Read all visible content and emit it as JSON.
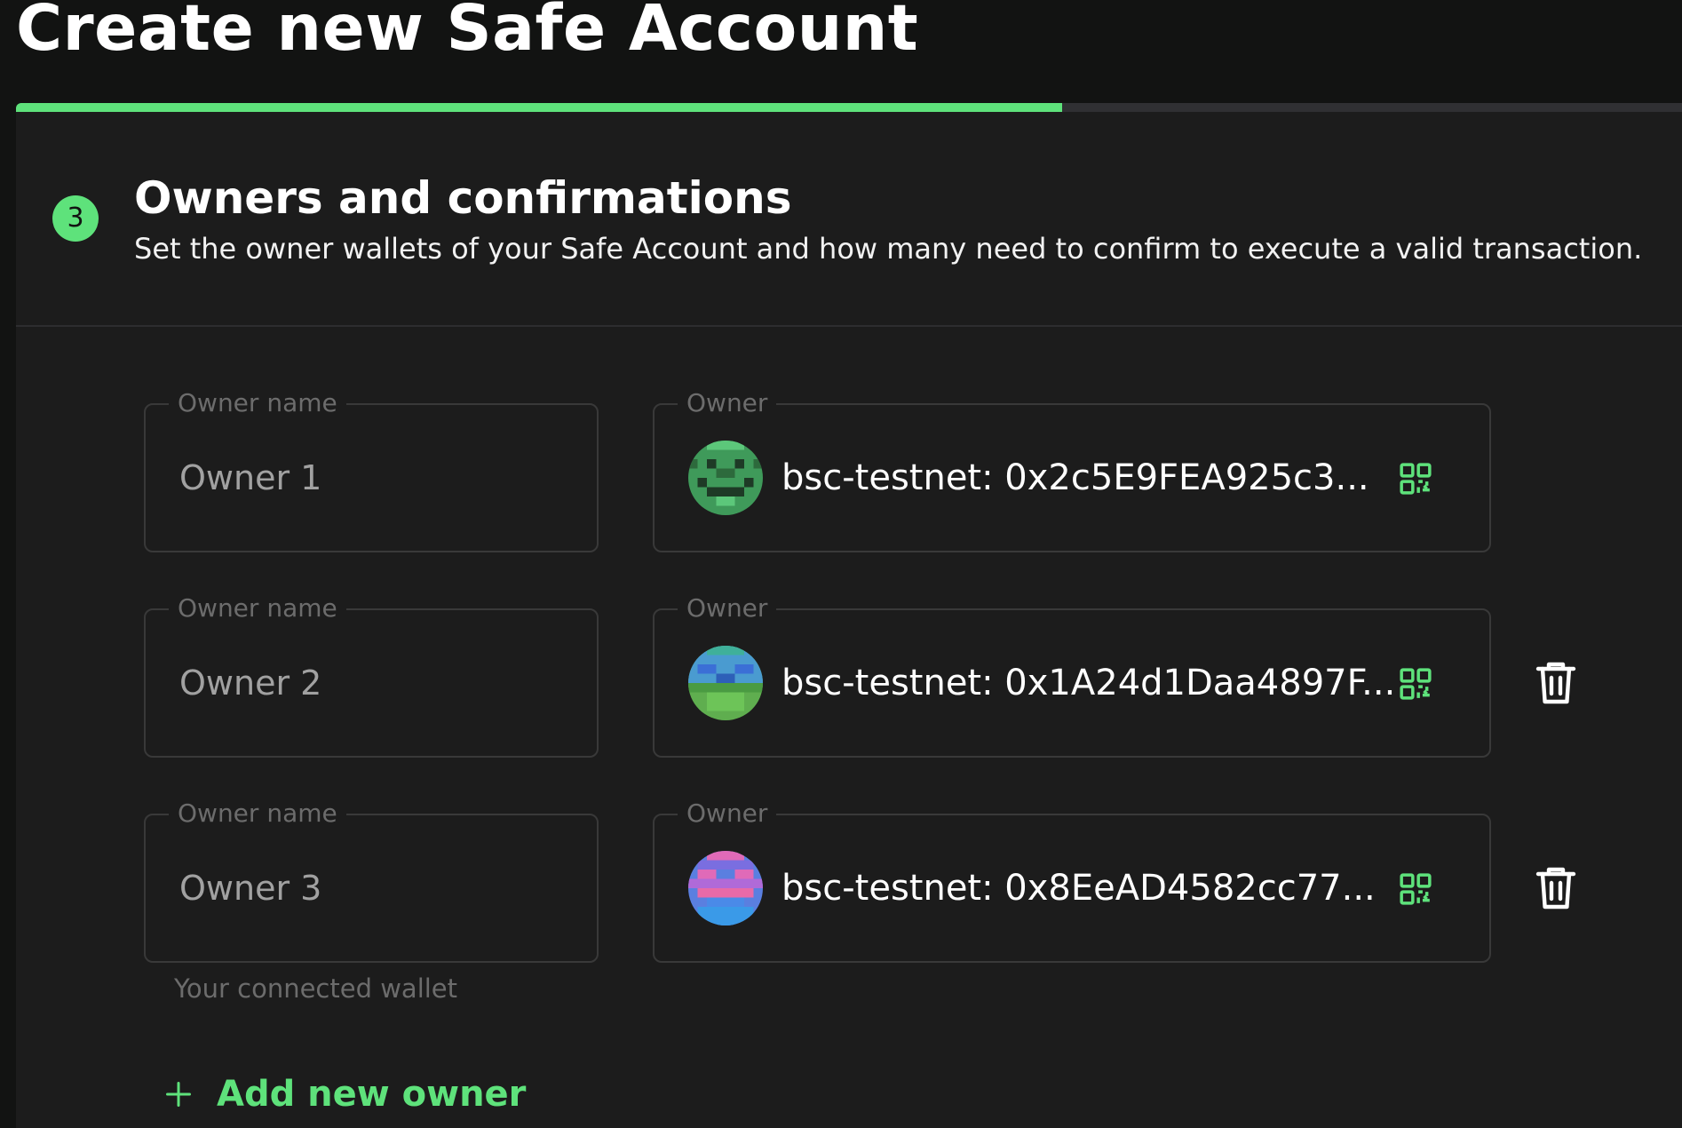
{
  "page": {
    "title": "Create new Safe Account"
  },
  "progress": {
    "percent": 62.8,
    "color": "#5ee27b"
  },
  "step": {
    "number": "3",
    "title": "Owners and confirmations",
    "subtitle": "Set the owner wallets of your Safe Account and how many need to confirm to execute a valid transaction."
  },
  "owners": [
    {
      "name_label": "Owner name",
      "name": "Owner 1",
      "address_label": "Owner",
      "address": "bsc-testnet: 0x2c5E9FEA925c3...",
      "deletable": false
    },
    {
      "name_label": "Owner name",
      "name": "Owner 2",
      "address_label": "Owner",
      "address": "bsc-testnet: 0x1A24d1Daa4897F...",
      "deletable": true
    },
    {
      "name_label": "Owner name",
      "name": "Owner 3",
      "address_label": "Owner",
      "address": "bsc-testnet: 0x8EeAD4582cc77...",
      "deletable": true
    }
  ],
  "helper_text": "Your connected wallet",
  "add_owner_label": "Add new owner",
  "icons": {
    "qr": "qr-code-icon",
    "delete": "trash-icon",
    "add": "plus-icon"
  },
  "colors": {
    "accent": "#5ee27b",
    "background": "#121312",
    "card": "#1c1c1c"
  }
}
